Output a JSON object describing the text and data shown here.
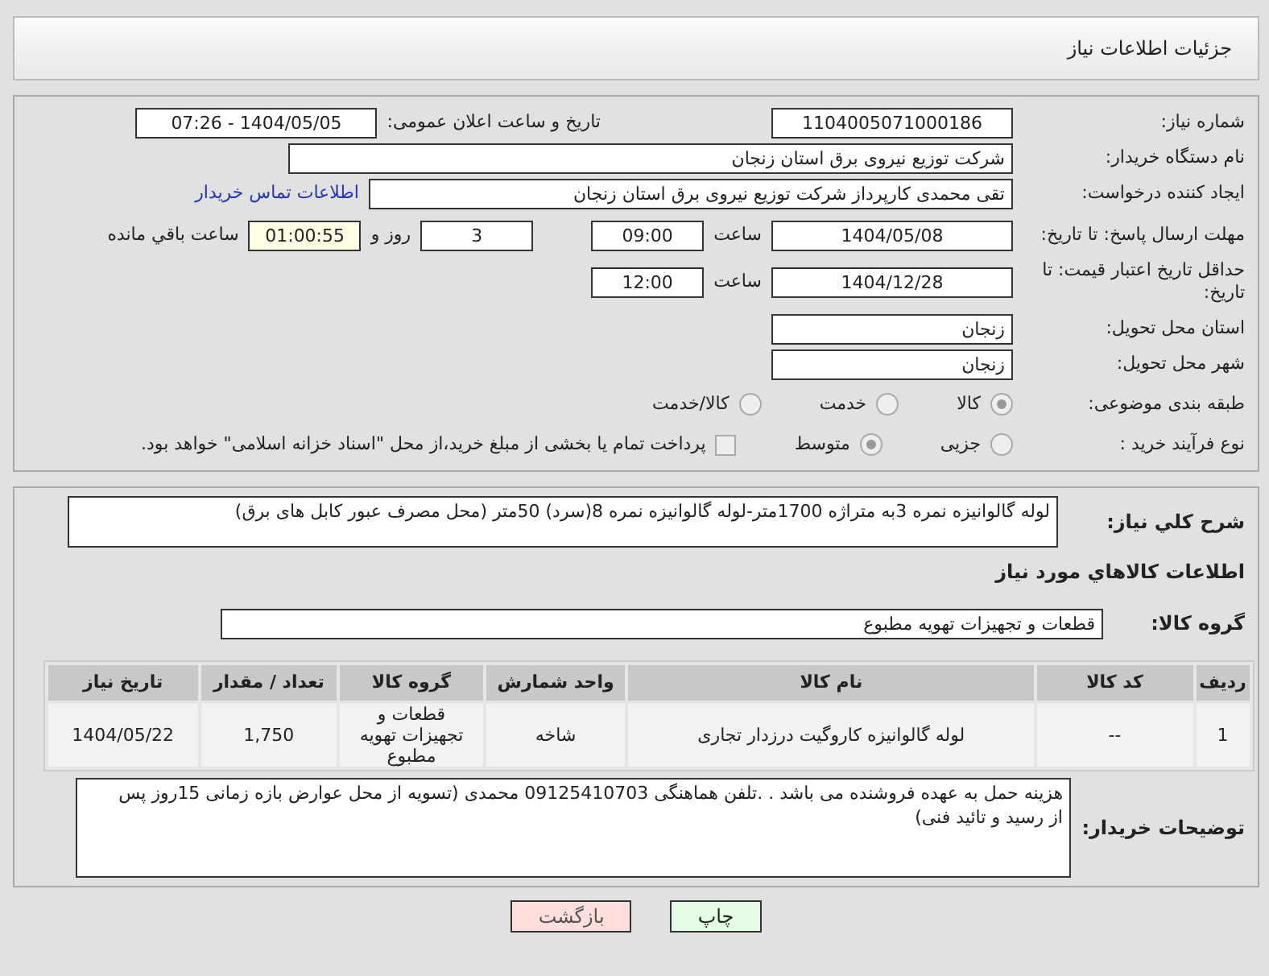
{
  "header": {
    "title": "جزئیات اطلاعات نیاز"
  },
  "need_number": {
    "label": "شماره نیاز:",
    "value": "1104005071000186"
  },
  "announce": {
    "label": "تاریخ و ساعت اعلان عمومی:",
    "value": "1404/05/05 - 07:26"
  },
  "buyer_org": {
    "label": "نام دستگاه خریدار:",
    "value": "شرکت توزیع نیروی برق استان زنجان"
  },
  "creator": {
    "label": "ایجاد کننده درخواست:",
    "value": "تقی محمدی کارپرداز شرکت توزیع نیروی برق استان زنجان",
    "link": "اطلاعات تماس خریدار"
  },
  "deadline": {
    "label": "مهلت ارسال پاسخ: تا تاریخ:",
    "date": "1404/05/08",
    "time_label": "ساعت",
    "time": "09:00",
    "days": "3",
    "days_label": "روز و",
    "remaining": "01:00:55",
    "remaining_label": "ساعت باقي مانده"
  },
  "price_validity": {
    "label": "حداقل تاریخ اعتبار قیمت: تا تاریخ:",
    "date": "1404/12/28",
    "time_label": "ساعت",
    "time": "12:00"
  },
  "province": {
    "label": "استان محل تحویل:",
    "value": "زنجان"
  },
  "city": {
    "label": "شهر محل تحویل:",
    "value": "زنجان"
  },
  "category": {
    "label": "طبقه بندی موضوعی:",
    "options": [
      {
        "label": "کالا",
        "selected": true
      },
      {
        "label": "خدمت",
        "selected": false
      },
      {
        "label": "کالا/خدمت",
        "selected": false
      }
    ]
  },
  "process": {
    "label": "نوع فرآیند خرید :",
    "options": [
      {
        "label": "جزیی",
        "selected": false
      },
      {
        "label": "متوسط",
        "selected": true
      }
    ],
    "treasury": {
      "checked": false,
      "text": "پرداخت تمام یا بخشی از مبلغ خرید،از محل \"اسناد خزانه اسلامی\" خواهد بود."
    }
  },
  "description": {
    "label": "شرح کلي نياز:",
    "value": "لوله گالوانیزه نمره   3به متراژه 1700متر-لوله گالوانیزه نمره   8(سرد) 50متر (محل مصرف عبور کابل های برق)"
  },
  "goods_section": {
    "title": "اطلاعات کالاهاي مورد نياز"
  },
  "goods_group": {
    "label": "گروه کالا:",
    "value": "قطعات و تجهیزات تهویه مطبوع"
  },
  "table": {
    "columns": [
      "ردیف",
      "کد کالا",
      "نام کالا",
      "واحد شمارش",
      "گروه کالا",
      "تعداد / مقدار",
      "تاریخ نیاز"
    ],
    "rows": [
      [
        "1",
        "--",
        "لوله گالوانیزه کاروگیت درزدار تجاری",
        "شاخه",
        "قطعات و تجهیزات تهویه مطبوع",
        "1,750",
        "1404/05/22"
      ]
    ]
  },
  "buyer_notes": {
    "label": "توضیحات خریدار:",
    "value": "هزینه حمل به عهده فروشنده می باشد . .تلفن هماهنگی 09125410703 محمدی (تسویه از محل عوارض  بازه زمانی 15روز پس از رسید و تائید فنی)"
  },
  "buttons": [
    {
      "label": "چاپ",
      "kind": "print"
    },
    {
      "label": "بازگشت",
      "kind": "back"
    }
  ]
}
